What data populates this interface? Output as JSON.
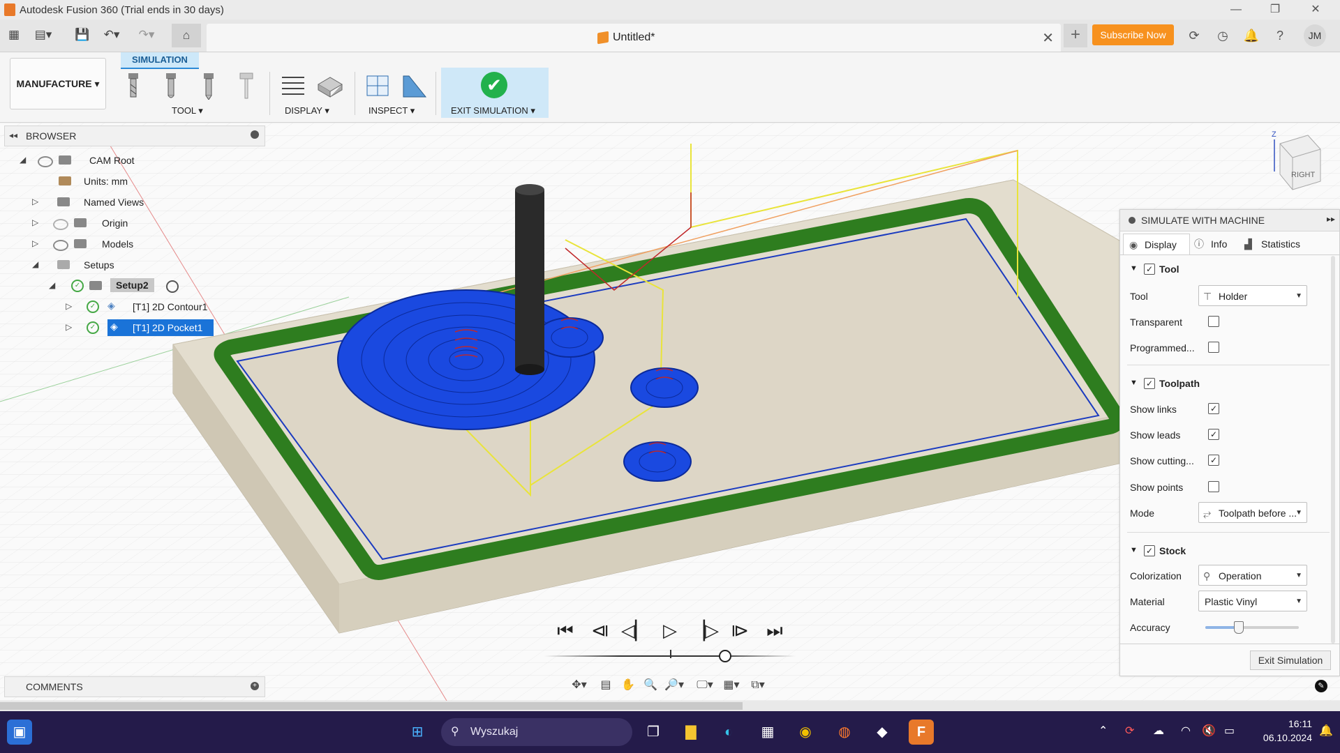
{
  "window": {
    "title": "Autodesk Fusion 360 (Trial ends in 30 days)",
    "minimize": "—",
    "restore": "❐",
    "close": "✕"
  },
  "tabs": {
    "doc_name": "Untitled*",
    "close": "✕",
    "add": "+",
    "subscribe": "Subscribe Now",
    "avatar": "JM"
  },
  "ribbon": {
    "workspace": "MANUFACTURE",
    "active_tab": "SIMULATION",
    "groups": {
      "tool": "TOOL",
      "display": "DISPLAY",
      "inspect": "INSPECT",
      "exit": "EXIT SIMULATION"
    }
  },
  "browser": {
    "title": "BROWSER",
    "items": [
      {
        "label": "CAM Root"
      },
      {
        "label": "Units: mm"
      },
      {
        "label": "Named Views"
      },
      {
        "label": "Origin"
      },
      {
        "label": "Models"
      },
      {
        "label": "Setups"
      },
      {
        "label": "Setup2"
      },
      {
        "label": "[T1] 2D Contour1"
      },
      {
        "label": "[T1] 2D Pocket1"
      }
    ]
  },
  "viewcube": {
    "face": "RIGHT",
    "axis": "Z"
  },
  "sim_panel": {
    "title": "SIMULATE WITH MACHINE",
    "tabs": {
      "display": "Display",
      "info": "Info",
      "statistics": "Statistics"
    },
    "tool": {
      "header": "Tool",
      "enabled": true,
      "tool_label": "Tool",
      "tool_value": "Holder",
      "transparent_label": "Transparent",
      "transparent": false,
      "programmed_label": "Programmed...",
      "programmed": false
    },
    "toolpath": {
      "header": "Toolpath",
      "enabled": true,
      "links_label": "Show links",
      "links": true,
      "leads_label": "Show leads",
      "leads": true,
      "cutting_label": "Show cutting...",
      "cutting": true,
      "points_label": "Show points",
      "points": false,
      "mode_label": "Mode",
      "mode_value": "Toolpath before ..."
    },
    "stock": {
      "header": "Stock",
      "enabled": true,
      "colorization_label": "Colorization",
      "colorization_value": "Operation",
      "material_label": "Material",
      "material_value": "Plastic Vinyl",
      "accuracy_label": "Accuracy",
      "accuracy": 0.35
    },
    "exit_button": "Exit Simulation"
  },
  "comments": {
    "title": "COMMENTS"
  },
  "playback": {
    "progress": 0.72
  },
  "taskbar": {
    "search": "Wyszukaj",
    "time": "16:11",
    "date": "06.10.2024"
  },
  "colors": {
    "accent": "#2b8ad7",
    "subscribe": "#f7911e",
    "pocket": "#1a49e0",
    "contour": "#2e7d1f",
    "stock": "#e2dccd",
    "taskbar": "#241b4a",
    "check": "#22b14c"
  }
}
